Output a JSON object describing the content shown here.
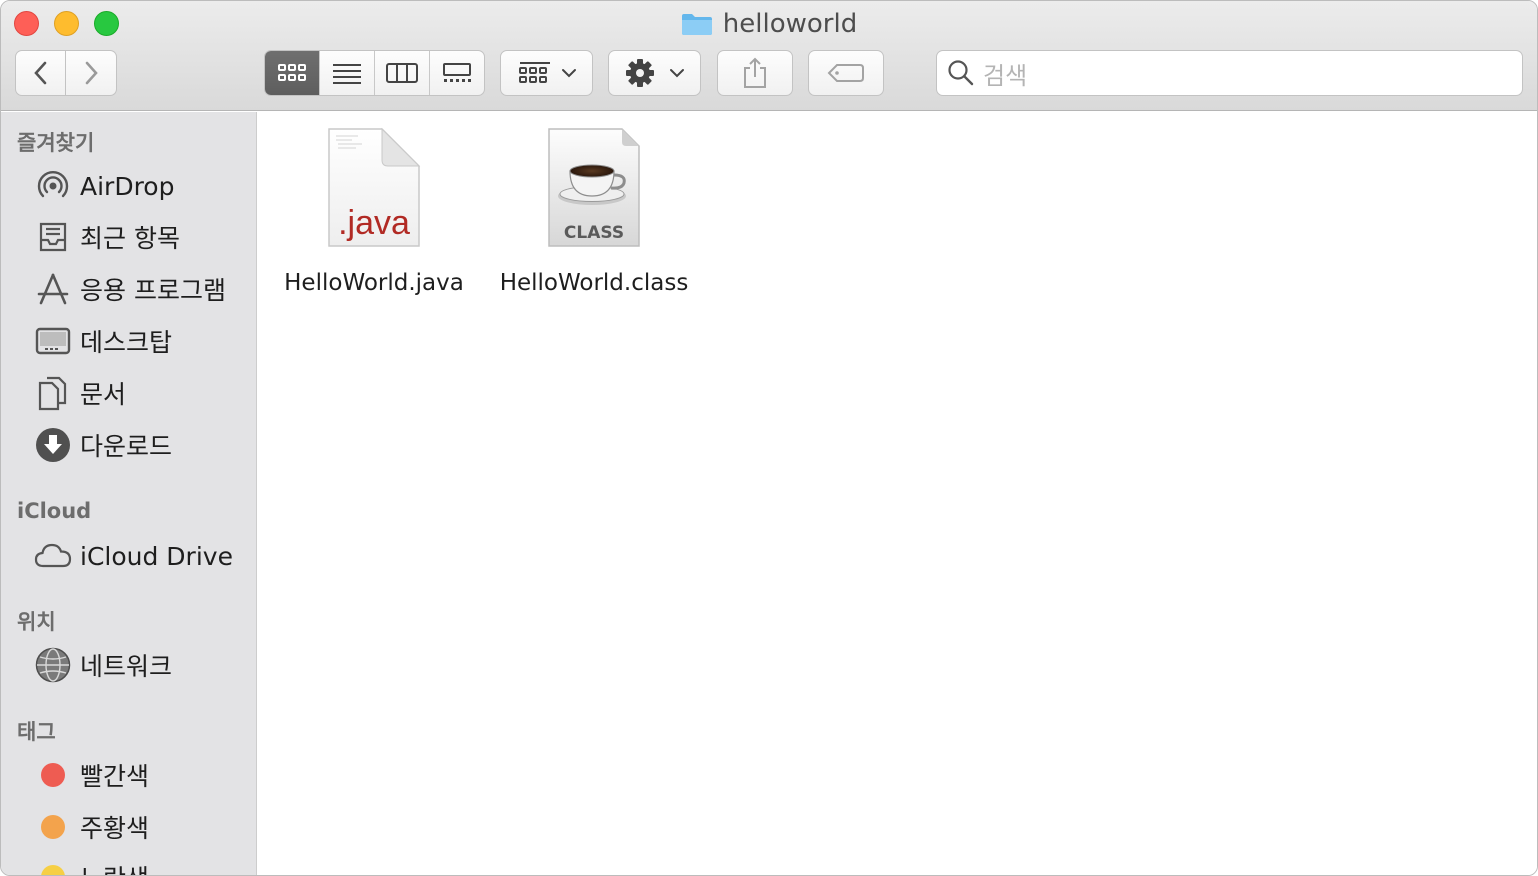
{
  "window": {
    "title": "helloworld"
  },
  "search": {
    "placeholder": "검색"
  },
  "sidebar": {
    "favorites_header": "즐겨찾기",
    "favorites": [
      {
        "label": "AirDrop",
        "icon": "airdrop-icon"
      },
      {
        "label": "최근 항목",
        "icon": "recents-icon"
      },
      {
        "label": "응용 프로그램",
        "icon": "applications-icon"
      },
      {
        "label": "데스크탑",
        "icon": "desktop-icon"
      },
      {
        "label": "문서",
        "icon": "documents-icon"
      },
      {
        "label": "다운로드",
        "icon": "downloads-icon"
      }
    ],
    "icloud_header": "iCloud",
    "icloud": [
      {
        "label": "iCloud Drive",
        "icon": "cloud-icon"
      }
    ],
    "locations_header": "위치",
    "locations": [
      {
        "label": "네트워크",
        "icon": "network-icon"
      }
    ],
    "tags_header": "태그",
    "tags": [
      {
        "label": "빨간색",
        "color": "#ee5c52"
      },
      {
        "label": "주황색",
        "color": "#f3a34c"
      },
      {
        "label": "노란색",
        "color": "#f6cf45"
      }
    ]
  },
  "files": [
    {
      "name": "HelloWorld.java",
      "icon": "java-file-icon",
      "badge": ".java"
    },
    {
      "name": "HelloWorld.class",
      "icon": "class-file-icon",
      "badge": "CLASS"
    }
  ],
  "colors": {
    "java_red": "#b12a24",
    "folder_blue": "#5fb5ea"
  }
}
